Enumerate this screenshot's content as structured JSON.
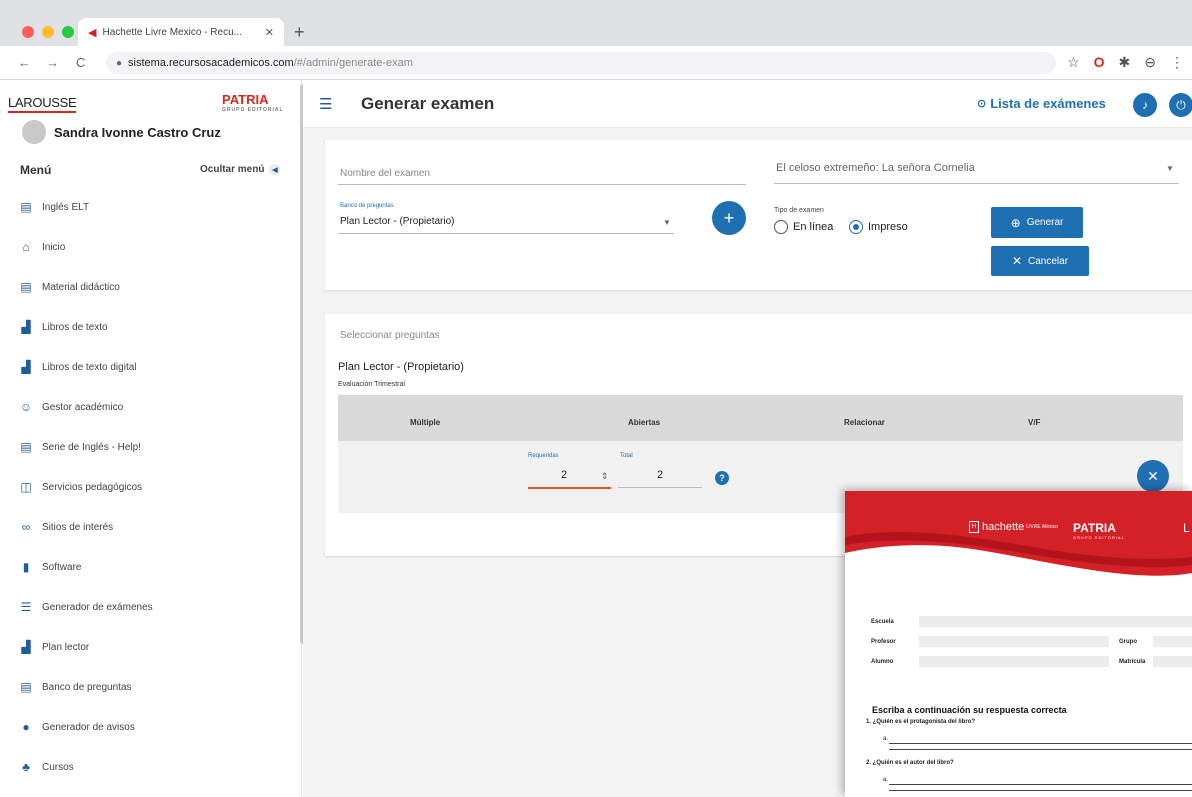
{
  "browser": {
    "tab_title": "Hachette Livre Mexico - Recu...",
    "url_domain": "sistema.recursosacademicos.com",
    "url_path": "/#/admin/generate-exam",
    "nav_back": "←",
    "nav_forward": "→",
    "nav_reload": "C",
    "new_tab": "+",
    "ext_icons": [
      "☆",
      "O",
      "✱",
      "⊖",
      "⋮"
    ]
  },
  "sidebar": {
    "brand_left": "LAROUSSE",
    "brand_right": "PATRIA",
    "brand_right_sub": "GRUPO EDITORIAL",
    "user_name": "Sandra Ivonne Castro Cruz",
    "menu_title": "Menú",
    "hide_menu": "Ocultar menú",
    "items": [
      {
        "label": "Inglés ELT",
        "icon": "book-icon"
      },
      {
        "label": "Inicio",
        "icon": "home-icon"
      },
      {
        "label": "Material didáctico",
        "icon": "book-icon"
      },
      {
        "label": "Libros de texto",
        "icon": "reader-icon"
      },
      {
        "label": "Libros de texto digital",
        "icon": "reader-icon"
      },
      {
        "label": "Gestor académico",
        "icon": "users-icon"
      },
      {
        "label": "Serie de Inglés - Help!",
        "icon": "book-icon"
      },
      {
        "label": "Servicios pedagógicos",
        "icon": "presentation-icon"
      },
      {
        "label": "Sitios de interés",
        "icon": "link-icon"
      },
      {
        "label": "Software",
        "icon": "file-icon"
      },
      {
        "label": "Generador de exámenes",
        "icon": "list-icon"
      },
      {
        "label": "Plan lector",
        "icon": "reader-icon"
      },
      {
        "label": "Banco de preguntas",
        "icon": "book-icon"
      },
      {
        "label": "Generador de avisos",
        "icon": "alert-icon"
      },
      {
        "label": "Cursos",
        "icon": "courses-icon"
      }
    ]
  },
  "header": {
    "title": "Generar examen",
    "list_link": "Lista de exámenes"
  },
  "form": {
    "exam_name_placeholder": "Nombre del examen",
    "book_select_value": "El celoso extremeño: La señora Cornelia",
    "bank_label": "Banco de preguntas",
    "bank_value": "Plan Lector - (Propietario)",
    "type_label": "Tipo de examen",
    "type_online": "En línea",
    "type_printed": "Impreso",
    "type_selected": "Impreso",
    "generate_label": "Generar",
    "cancel_label": "Cancelar"
  },
  "questions": {
    "section_title": "Seleccionar preguntas",
    "bank_name": "Plan Lector - (Propietario)",
    "evaluation": "Evaluación Trimestral",
    "columns": [
      "Múltiple",
      "Abiertas",
      "Relacionar",
      "V/F"
    ],
    "required_label": "Requeridas",
    "required_value": "2",
    "total_label": "Total",
    "total_value": "2"
  },
  "printout": {
    "logo_hachette": "hachette",
    "logo_hachette_sub": "LIVRE México",
    "logo_patria": "PATRIA",
    "logo_patria_sub": "GRUPO EDITORIAL",
    "logo_larousse_partial": "L",
    "fields": {
      "school": "Escuela",
      "teacher": "Profesor",
      "group": "Grupo",
      "student": "Alumno",
      "enrollment": "Matrícula"
    },
    "instruction": "Escriba a continuación su respuesta correcta",
    "questions": [
      "1. ¿Quién es el protagonista del libro?",
      "2. ¿Quién es el autor del libro?"
    ],
    "answer_prefix": "a."
  },
  "colors": {
    "accent": "#1f6fb3",
    "brand_red": "#d52b1e"
  }
}
